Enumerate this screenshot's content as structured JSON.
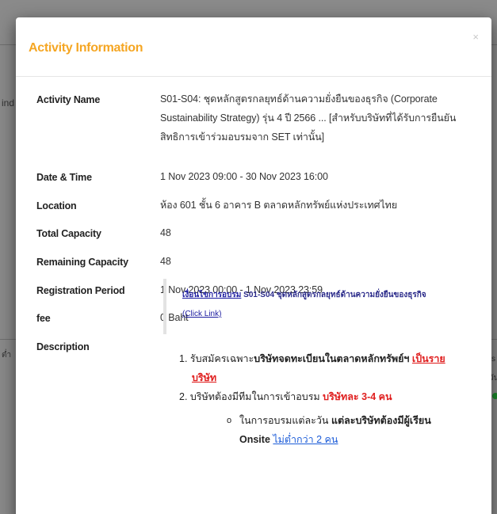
{
  "background": {
    "fragments": [
      "ind",
      "ต่ำ",
      "ss",
      "วัน"
    ]
  },
  "modal": {
    "title": "Activity Information",
    "close_glyph": "×",
    "fields": [
      {
        "label": "Activity Name",
        "value": "S01-S04: ชุดหลักสูตรกลยุทธ์ด้านความยั่งยืนของธุรกิจ (Corporate Sustainability Strategy) รุ่น 4 ปี 2566 ... [สำหรับบริษัทที่ได้รับการยืนยันสิทธิการเข้าร่วมอบรมจาก SET เท่านั้น]"
      },
      {
        "label": "Date & Time",
        "value": "1 Nov 2023 09:00 - 30 Nov 2023 16:00"
      },
      {
        "label": "Location",
        "value": "ห้อง 601 ชั้น 6 อาคาร B ตลาดหลักทรัพย์แห่งประเทศไทย"
      },
      {
        "label": "Total Capacity",
        "value": "48"
      },
      {
        "label": "Remaining Capacity",
        "value": "48"
      },
      {
        "label": "Registration Period",
        "value": "1 Nov 2023 00:00 - 1 Nov 2023 23:59"
      },
      {
        "label": "fee",
        "value": "0 Baht"
      },
      {
        "label": "Description",
        "value": ""
      }
    ],
    "description": {
      "link_text": "เงื่อนไขการอบรม",
      "heading": "S01-S04 ชุดหลักสูตรกลยุทธ์ด้านความยั่งยืนของธุรกิจ",
      "click_link": "(Click Link)",
      "items": [
        {
          "prefix": "1. รับสมัครเฉพาะ",
          "bold": "บริษัทจดทะเบียนในตลาดหลักทรัพย์ฯ",
          "red_underline_1": "เป็นราย",
          "red_underline_2": "บริษัท"
        },
        {
          "prefix": "2. บริษัทต้องมีทีมในการเข้าอบรม",
          "red": "บริษัทละ 3-4 คน"
        }
      ],
      "sub_item": {
        "bullet": "o",
        "prefix": "ในการอบรมแต่ละวัน",
        "bold_1": "แต่ละบริษัทต้องมีผู้เรียน",
        "bold_2": "Onsite",
        "blue_underline": "ไม่ต่ำกว่า 2 คน"
      }
    }
  },
  "colors": {
    "title": "#f5a623",
    "overlay": "#7d7d7d",
    "red": "#e02020",
    "link_blue": "#1c5cd8"
  }
}
